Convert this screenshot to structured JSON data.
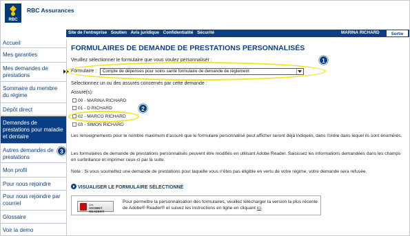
{
  "header": {
    "brand": "RBC Assurances",
    "logo_text": "RBC"
  },
  "utility_nav": {
    "links": [
      "Site de l'entreprise",
      "Soutien",
      "Avis juridique",
      "Confidentialité",
      "Sécurité"
    ],
    "user_name": "MARINA RICHARD",
    "logout_label": "Sortie"
  },
  "sidebar": {
    "items": [
      {
        "label": "Accueil"
      },
      {
        "label": "Mes garanties"
      },
      {
        "label": "Mes demandes de prestations"
      },
      {
        "label": "Sommaire du membre du régime"
      },
      {
        "label": "Dépôt direct"
      },
      {
        "label": "Demandes de prestations pour maladie et dentaire",
        "active": true
      },
      {
        "label": "Autres demandes de prestations"
      },
      {
        "label": "Mon profil"
      },
      {
        "label": "Pour nous rejoindre"
      },
      {
        "label": "Pour nous rejoindre par courriel"
      },
      {
        "label": "Glossaire"
      },
      {
        "label": "Voir la demo"
      }
    ]
  },
  "main": {
    "title": "FORMULAIRES DE DEMANDE DE PRESTATIONS PERSONNALISÉS",
    "select_prompt": "Veuillez sélectionner le formulaire que vous voulez personnaliser :",
    "form_label": "Formulaire :",
    "form_value": "Compte de dépenses pour soins santé formulaire de demande de règlement",
    "insured_prompt": "Sélectionnez un ou des assurés concernés par cette demande :",
    "insured_label": "Assuré(s):",
    "insured": [
      {
        "label": "00 - MARINA RICHARD",
        "checked": false
      },
      {
        "label": "01 - D RICHARD",
        "checked": false
      },
      {
        "label": "02 - MARCO RICHARD",
        "checked": false
      },
      {
        "label": "03 - SIMON RICHARD",
        "checked": false
      }
    ],
    "para1": "Les renseignements pour le nombre maximum d'assuré que le formulaire personnalisé peut afficher seront déjà indiqués, dans l'ordre dans lequel ils sont énumérés.",
    "para2": "Les formulaires de demande de prestations personnalisés peuvent être modifiés en utilisant Adobe Reader. Saisissez les informations demandées dans les champs en surbrillance et imprimer ceux-ci par la suite.",
    "para3": "Note : Si vous soumettez une demande de prestations pour laquelle vous n'êtes pas éligible en vertu de votre régime, votre demande sera refusée.",
    "view_link": "VISUALISER LE FORMULAIRE SÉLECTIONNÉ",
    "adobe_button": {
      "get": "Get",
      "product": "ADOBE® READER®"
    },
    "adobe_text": "Pour permettre la personnalisation des formulaires, veuillez télécharger la version la plus récente de Adobe® Reader® et suivez les instructions en ligne en cliquant",
    "adobe_link": "ici",
    "adobe_text_end": "."
  },
  "annotations": {
    "badges": [
      "1",
      "2",
      "3"
    ],
    "highlight_color": "#f4e21a",
    "badge_color": "#0a3f86"
  },
  "colors": {
    "brand_blue": "#0a3f86"
  }
}
